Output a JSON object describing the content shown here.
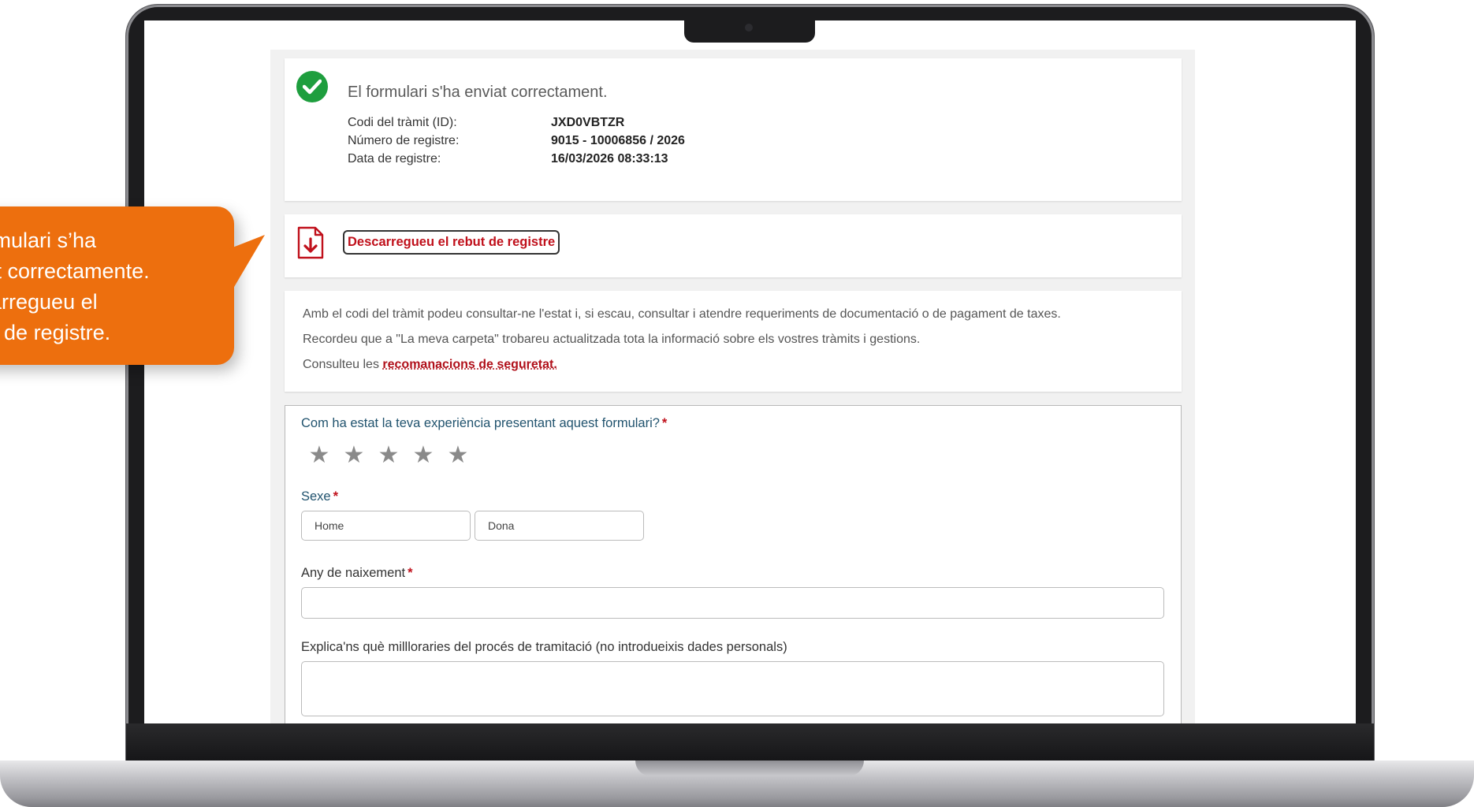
{
  "callout": {
    "lines": "formulari s’ha\nviat correctamente.\nscarregueu el\nbut de registre.",
    "color": "#ed6f0e"
  },
  "success": {
    "title": "El formulari s'ha enviat correctament.",
    "details": [
      {
        "label": "Codi del tràmit (ID):",
        "value": "JXD0VBTZR"
      },
      {
        "label": "Número de registre:",
        "value": "9015 - 10006856 / 2026"
      },
      {
        "label": "Data de registre:",
        "value": "16/03/2026 08:33:13"
      }
    ]
  },
  "download": {
    "button_label": "Descarregueu el rebut de registre",
    "icon": "pdf-download-icon"
  },
  "info": {
    "line1": "Amb el codi del tràmit podeu consultar-ne l'estat i, si escau, consultar i atendre requeriments de documentació o de pagament de taxes.",
    "line2": "Recordeu que a \"La meva carpeta\" trobareu actualitzada tota la informació sobre els vostres tràmits i gestions.",
    "line3_prefix": "Consulteu les ",
    "line3_link": "recomanacions de seguretat."
  },
  "survey": {
    "rating_question": "Com ha estat la teva experiència presentant aquest formulari?",
    "required_mark": "*",
    "rating_value": 0,
    "rating_max": 5,
    "sex_label": "Sexe",
    "sex_options": [
      "Home",
      "Dona"
    ],
    "birth_year_label": "Any de naixement",
    "birth_year_value": "",
    "improvements_label": "Explica'ns què millloraries del procés de tramitació (no introdueixis dades personals)",
    "improvements_value": ""
  },
  "colors": {
    "accent_red": "#c0101b",
    "success_green": "#1e9e3e",
    "question_blue": "#21536e"
  }
}
